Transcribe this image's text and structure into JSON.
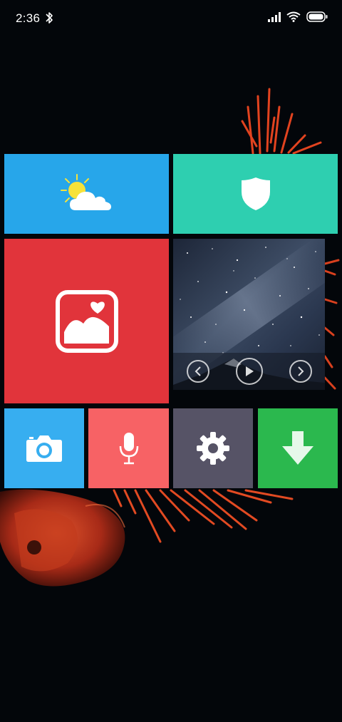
{
  "status_bar": {
    "time": "2:36",
    "icons": [
      "bluetooth-icon",
      "signal-icon",
      "wifi-icon",
      "battery-icon"
    ]
  },
  "tiles": [
    {
      "name": "weather",
      "icon": "weather-icon",
      "color": "#27a6ea"
    },
    {
      "name": "security",
      "icon": "shield-icon",
      "color": "#2ecfb0"
    },
    {
      "name": "gallery",
      "icon": "gallery-icon",
      "color": "#e1343b"
    },
    {
      "name": "photo-frame",
      "icon": "photo-slideshow",
      "controls": [
        "previous-icon",
        "play-icon",
        "next-icon"
      ]
    },
    {
      "name": "camera",
      "icon": "camera-icon",
      "color": "#37aef0"
    },
    {
      "name": "recorder",
      "icon": "microphone-icon",
      "color": "#f76265"
    },
    {
      "name": "settings",
      "icon": "gear-icon",
      "color": "#565366"
    },
    {
      "name": "downloads",
      "icon": "download-arrow-icon",
      "color": "#2bb84e"
    }
  ]
}
